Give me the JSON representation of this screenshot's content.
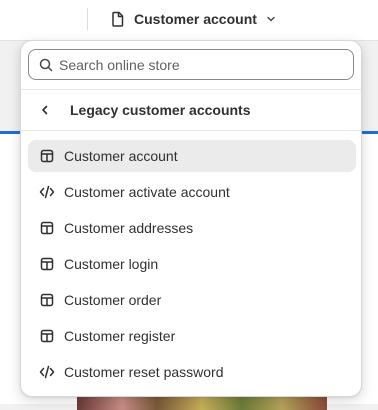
{
  "header": {
    "template_title": "Customer account",
    "template_icon": "page-icon",
    "chevron_icon": "chevron-down-icon"
  },
  "dropdown": {
    "search": {
      "placeholder": "Search online store",
      "value": ""
    },
    "back": {
      "label": "Legacy customer accounts",
      "icon": "chevron-left-icon"
    },
    "items": [
      {
        "label": "Customer account",
        "icon": "layout-icon",
        "selected": true
      },
      {
        "label": "Customer activate account",
        "icon": "code-icon",
        "selected": false
      },
      {
        "label": "Customer addresses",
        "icon": "layout-icon",
        "selected": false
      },
      {
        "label": "Customer login",
        "icon": "layout-icon",
        "selected": false
      },
      {
        "label": "Customer order",
        "icon": "layout-icon",
        "selected": false
      },
      {
        "label": "Customer register",
        "icon": "layout-icon",
        "selected": false
      },
      {
        "label": "Customer reset password",
        "icon": "code-icon",
        "selected": false
      }
    ]
  },
  "colors": {
    "accent": "#1f6fd6",
    "selected_bg": "#ebebeb",
    "text": "#303030"
  }
}
